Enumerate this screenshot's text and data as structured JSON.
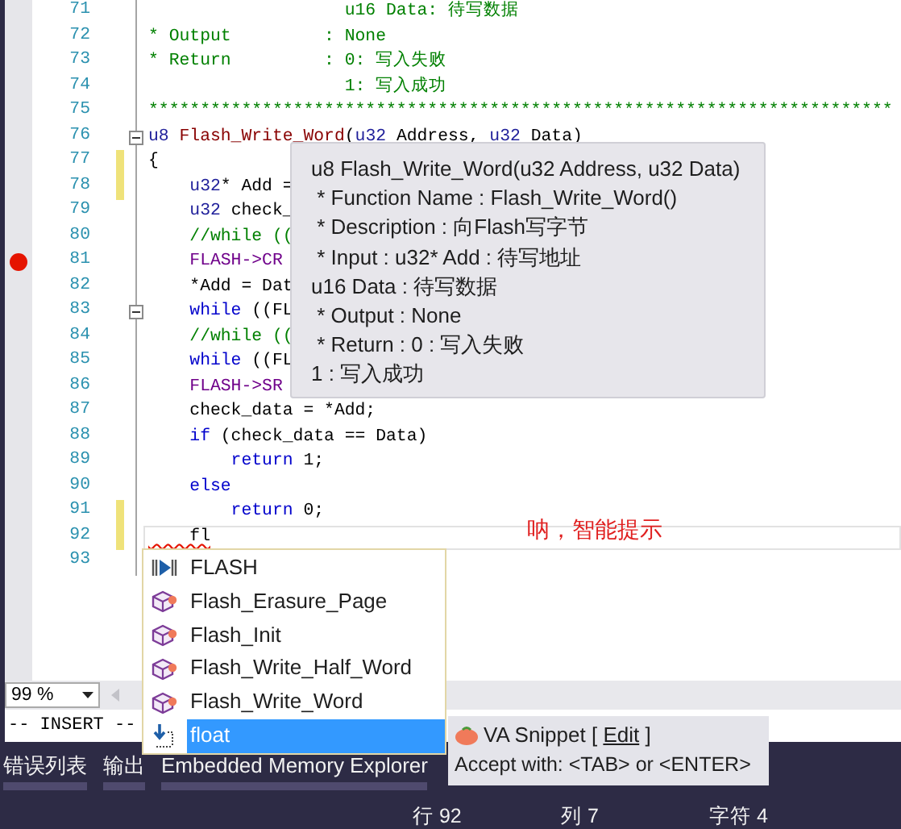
{
  "editor": {
    "lines": [
      {
        "number": "71",
        "tokens": [
          {
            "kind": "comment",
            "text": "                   u16 Data: 待写数据"
          }
        ],
        "changed": false,
        "breakpoint": false,
        "fold": false,
        "current": false
      },
      {
        "number": "72",
        "tokens": [
          {
            "kind": "comment",
            "text": "* Output         : None"
          }
        ],
        "changed": false,
        "breakpoint": false,
        "fold": false,
        "current": false
      },
      {
        "number": "73",
        "tokens": [
          {
            "kind": "comment",
            "text": "* Return         : 0: 写入失败"
          }
        ],
        "changed": false,
        "breakpoint": false,
        "fold": false,
        "current": false
      },
      {
        "number": "74",
        "tokens": [
          {
            "kind": "comment",
            "text": "                   1: 写入成功"
          }
        ],
        "changed": false,
        "breakpoint": false,
        "fold": false,
        "current": false
      },
      {
        "number": "75",
        "tokens": [
          {
            "kind": "comment",
            "text": "************************************************************************"
          }
        ],
        "changed": false,
        "breakpoint": false,
        "fold": false,
        "current": false
      },
      {
        "number": "76",
        "tokens": [
          {
            "kind": "type",
            "text": "u8"
          },
          {
            "kind": "function",
            "text": " Flash_Write_Word"
          },
          {
            "kind": "plain",
            "text": "("
          },
          {
            "kind": "type",
            "text": "u32"
          },
          {
            "kind": "plain",
            "text": " Address, "
          },
          {
            "kind": "type",
            "text": "u32"
          },
          {
            "kind": "plain",
            "text": " Data)"
          }
        ],
        "changed": false,
        "breakpoint": false,
        "fold": true,
        "current": false
      },
      {
        "number": "77",
        "tokens": [
          {
            "kind": "plain",
            "text": "{"
          }
        ],
        "changed": true,
        "breakpoint": false,
        "fold": false,
        "current": false
      },
      {
        "number": "78",
        "tokens": [
          {
            "kind": "type",
            "text": "    u32"
          },
          {
            "kind": "plain",
            "text": "* Add ="
          }
        ],
        "changed": true,
        "breakpoint": false,
        "fold": false,
        "current": false
      },
      {
        "number": "79",
        "tokens": [
          {
            "kind": "type",
            "text": "    u32"
          },
          {
            "kind": "plain",
            "text": " check_"
          }
        ],
        "changed": false,
        "breakpoint": false,
        "fold": false,
        "current": false
      },
      {
        "number": "80",
        "tokens": [
          {
            "kind": "comment",
            "text": "    //while (("
          }
        ],
        "changed": false,
        "breakpoint": false,
        "fold": false,
        "current": false
      },
      {
        "number": "81",
        "tokens": [
          {
            "kind": "macro",
            "text": "    FLASH->CR"
          }
        ],
        "changed": false,
        "breakpoint": true,
        "fold": false,
        "current": false
      },
      {
        "number": "82",
        "tokens": [
          {
            "kind": "plain",
            "text": "    *Add = Dat"
          }
        ],
        "changed": false,
        "breakpoint": false,
        "fold": false,
        "current": false
      },
      {
        "number": "83",
        "tokens": [
          {
            "kind": "keyword",
            "text": "    while"
          },
          {
            "kind": "plain",
            "text": " ((FL"
          }
        ],
        "changed": false,
        "breakpoint": false,
        "fold": true,
        "current": false
      },
      {
        "number": "84",
        "tokens": [
          {
            "kind": "comment",
            "text": "    //while (("
          }
        ],
        "changed": false,
        "breakpoint": false,
        "fold": false,
        "current": false
      },
      {
        "number": "85",
        "tokens": [
          {
            "kind": "keyword",
            "text": "    while"
          },
          {
            "kind": "plain",
            "text": " ((FL"
          }
        ],
        "changed": false,
        "breakpoint": false,
        "fold": false,
        "current": false
      },
      {
        "number": "86",
        "tokens": [
          {
            "kind": "macro",
            "text": "    FLASH->SR"
          }
        ],
        "changed": false,
        "breakpoint": false,
        "fold": false,
        "current": false
      },
      {
        "number": "87",
        "tokens": [
          {
            "kind": "plain",
            "text": "    check_data = *Add;"
          }
        ],
        "changed": false,
        "breakpoint": false,
        "fold": false,
        "current": false
      },
      {
        "number": "88",
        "tokens": [
          {
            "kind": "keyword",
            "text": "    if"
          },
          {
            "kind": "plain",
            "text": " (check_data == Data)"
          }
        ],
        "changed": false,
        "breakpoint": false,
        "fold": false,
        "current": false
      },
      {
        "number": "89",
        "tokens": [
          {
            "kind": "keyword",
            "text": "        return"
          },
          {
            "kind": "plain",
            "text": " 1;"
          }
        ],
        "changed": false,
        "breakpoint": false,
        "fold": false,
        "current": false
      },
      {
        "number": "90",
        "tokens": [
          {
            "kind": "keyword",
            "text": "    else"
          }
        ],
        "changed": false,
        "breakpoint": false,
        "fold": false,
        "current": false
      },
      {
        "number": "91",
        "tokens": [
          {
            "kind": "keyword",
            "text": "        return"
          },
          {
            "kind": "plain",
            "text": " 0;"
          }
        ],
        "changed": true,
        "breakpoint": false,
        "fold": false,
        "current": false
      },
      {
        "number": "92",
        "tokens": [
          {
            "kind": "error",
            "text": "    fl"
          }
        ],
        "changed": true,
        "breakpoint": false,
        "fold": false,
        "current": true
      },
      {
        "number": "93",
        "changed": false,
        "breakpoint": false,
        "fold": false,
        "current": false
      }
    ],
    "annotation": "呐，智能提示"
  },
  "quick_info": {
    "lines": [
      "u8 Flash_Write_Word(u32 Address, u32 Data)",
      " * Function Name : Flash_Write_Word()",
      " * Description : 向Flash写字节",
      " * Input : u32* Add : 待写地址",
      "u16 Data : 待写数据",
      " * Output : None",
      " * Return : 0 : 写入失败",
      "1 : 写入成功"
    ]
  },
  "completion": {
    "items": [
      {
        "label": "FLASH",
        "kind": "macro",
        "selected": false
      },
      {
        "label": "Flash_Erasure_Page",
        "kind": "function",
        "selected": false
      },
      {
        "label": "Flash_Init",
        "kind": "function",
        "selected": false
      },
      {
        "label": "Flash_Write_Half_Word",
        "kind": "function",
        "selected": false
      },
      {
        "label": "Flash_Write_Word",
        "kind": "function",
        "selected": false
      },
      {
        "label": "float",
        "kind": "snippet",
        "selected": true
      }
    ]
  },
  "snippet_tip": {
    "prefix": "VA Snippet [ ",
    "link": "Edit",
    "suffix": " ]",
    "hint": "Accept with: <TAB> or <ENTER>"
  },
  "zoom": {
    "value": "99 %"
  },
  "mode": "-- INSERT --",
  "panel_tabs": [
    {
      "label": "错误列表"
    },
    {
      "label": "输出"
    },
    {
      "label": "Embedded Memory Explorer"
    }
  ],
  "status_bar": {
    "line": "行 92",
    "column": "列 7",
    "char": "字符 4"
  }
}
